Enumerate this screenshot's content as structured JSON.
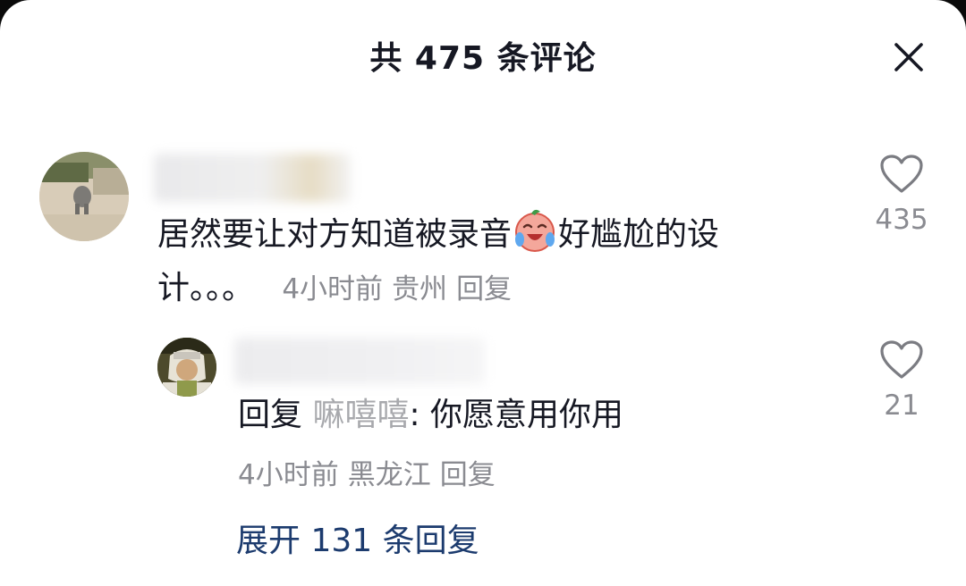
{
  "header": {
    "title": "共 475 条评论",
    "close_icon": "close-icon"
  },
  "comment": {
    "avatar": "avatar",
    "text_before_emoji": "居然要让对方知道被录音",
    "emoji": "crying-laughing-emoji",
    "text_after_emoji": "好尴尬的设计。。。",
    "time": "4小时前",
    "location": "贵州",
    "reply_label": "回复",
    "like_icon": "heart-icon",
    "like_count": "435"
  },
  "reply": {
    "prefix": "回复 ",
    "to_name": "嘛嘻嘻",
    "text": ": 你愿意用你用",
    "time": "4小时前",
    "location": "黑龙江",
    "reply_label": "回复",
    "like_icon": "heart-icon",
    "like_count": "21"
  },
  "expand": {
    "label": "展开 131 条回复"
  },
  "colors": {
    "text_primary": "#161823",
    "text_secondary": "#8a8b91",
    "link_blue": "#1c3b6e"
  }
}
